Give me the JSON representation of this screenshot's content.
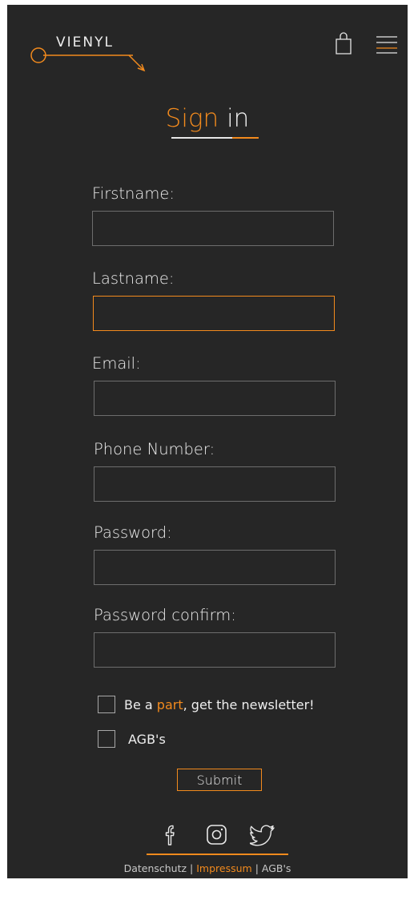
{
  "brand": {
    "name": "VIENYL"
  },
  "header": {
    "cart_icon": "shopping-bag-icon",
    "menu_icon": "hamburger-menu-icon"
  },
  "title": {
    "part1": "Sign",
    "part2": "in"
  },
  "form": {
    "fields": [
      {
        "label": "Firstname:",
        "value": "",
        "focused": false
      },
      {
        "label": "Lastname:",
        "value": "",
        "focused": true
      },
      {
        "label": "Email:",
        "value": "",
        "focused": false
      },
      {
        "label": "Phone Number:",
        "value": "",
        "focused": false
      },
      {
        "label": "Password:",
        "value": "",
        "focused": false
      },
      {
        "label": "Password confirm:",
        "value": "",
        "focused": false
      }
    ],
    "newsletter": {
      "before": "Be a ",
      "highlight": "part",
      "after": ", get the newsletter!",
      "checked": false
    },
    "agb": {
      "label": "AGB's",
      "checked": false
    },
    "submit_label": "Submit"
  },
  "social": {
    "icons": [
      "facebook-icon",
      "instagram-icon",
      "twitter-icon"
    ]
  },
  "footer": {
    "link1": "Datenschutz",
    "sep1": " | ",
    "link2": "Impressum",
    "sep2": " | ",
    "link3": "AGB's"
  },
  "colors": {
    "accent": "#f28a1d",
    "background": "#262626",
    "text": "#eeeeee",
    "field_border": "#6d6d6d"
  }
}
